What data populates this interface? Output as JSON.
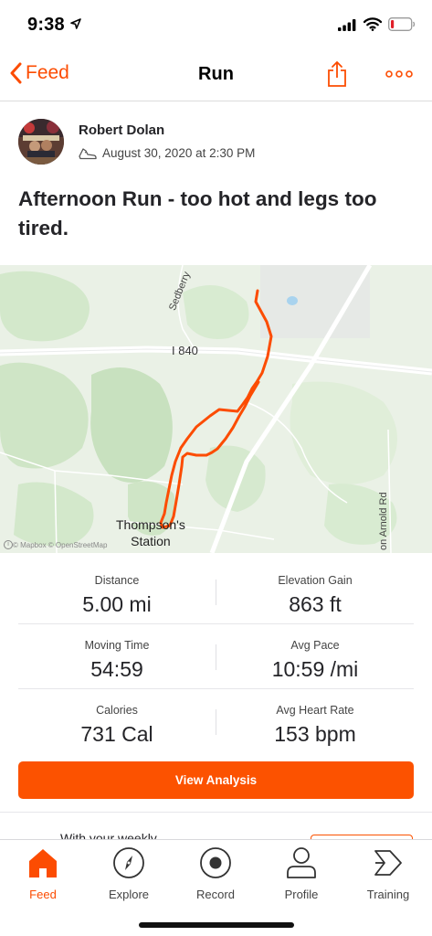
{
  "status_bar": {
    "time": "9:38"
  },
  "nav": {
    "back_label": "Feed",
    "title": "Run"
  },
  "athlete": {
    "name": "Robert Dolan",
    "date": "August 30, 2020 at 2:30 PM"
  },
  "activity": {
    "title": "Afternoon Run - too hot and legs too tired."
  },
  "map": {
    "labels": {
      "highway": "I 840",
      "road_north": "Sedberry",
      "town_line1": "Thompson's",
      "town_line2": "Station",
      "road_east": "on Arnold Rd",
      "attribution": "© Mapbox © OpenStreetMap"
    },
    "route_color": "#fc4c02"
  },
  "stats": [
    {
      "label": "Distance",
      "value": "5.00 mi"
    },
    {
      "label": "Elevation Gain",
      "value": "863 ft"
    },
    {
      "label": "Moving Time",
      "value": "54:59"
    },
    {
      "label": "Avg Pace",
      "value": "10:59 /mi"
    },
    {
      "label": "Calories",
      "value": "731 Cal"
    },
    {
      "label": "Avg Heart Rate",
      "value": "153 bpm"
    }
  ],
  "actions": {
    "view_analysis": "View Analysis",
    "peek_text": "With your weekly"
  },
  "tabs": [
    {
      "label": "Feed",
      "icon": "home-icon",
      "active": true
    },
    {
      "label": "Explore",
      "icon": "compass-icon",
      "active": false
    },
    {
      "label": "Record",
      "icon": "record-icon",
      "active": false
    },
    {
      "label": "Profile",
      "icon": "profile-icon",
      "active": false
    },
    {
      "label": "Training",
      "icon": "training-icon",
      "active": false
    }
  ],
  "colors": {
    "brand": "#fc4c02",
    "button": "#fc5200",
    "text": "#242428"
  }
}
